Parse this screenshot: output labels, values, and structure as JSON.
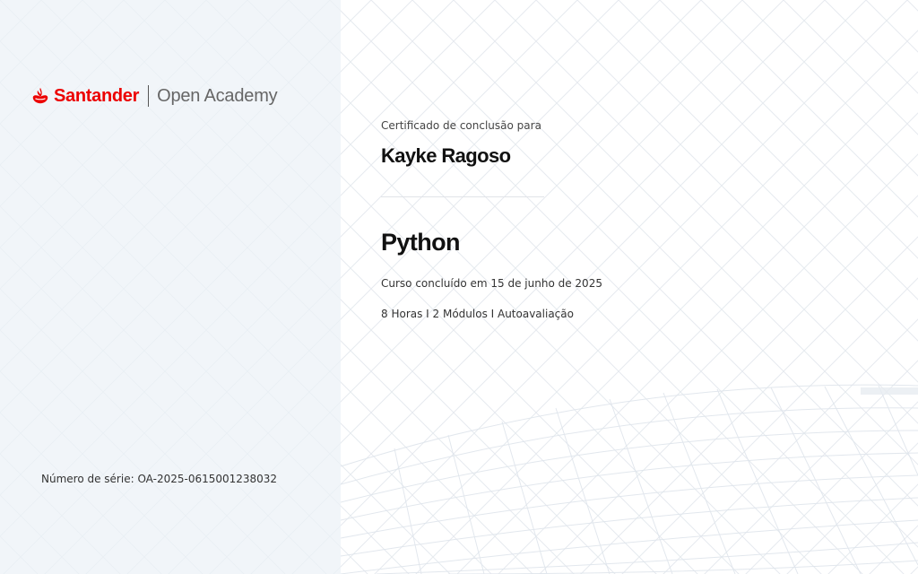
{
  "brand": {
    "name": "Santander",
    "product": "Open Academy",
    "accent_color": "#ec0000",
    "icon": "santander-flame-icon"
  },
  "certificate": {
    "label": "Certificado de conclusão para",
    "recipient": "Kayke Ragoso",
    "course": "Python",
    "completed": "Curso concluído em 15 de junho de 2025",
    "details": "8 Horas I 2 Módulos I Autoavaliação",
    "serial": "Número de série: OA-2025-0615001238032"
  }
}
